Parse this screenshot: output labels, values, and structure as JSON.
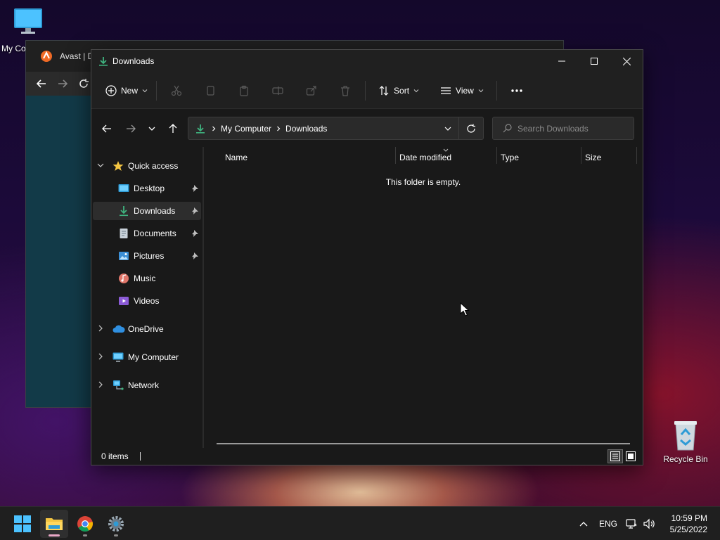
{
  "desktop": {
    "icons": [
      {
        "label": "My Co"
      },
      {
        "label": "Recycle Bin"
      }
    ]
  },
  "background_window": {
    "title": "Avast | Do"
  },
  "explorer": {
    "title": "Downloads",
    "commandbar": {
      "new_label": "New",
      "sort_label": "Sort",
      "view_label": "View"
    },
    "address": {
      "crumbs": [
        "My Computer",
        "Downloads"
      ]
    },
    "search": {
      "placeholder": "Search Downloads"
    },
    "navigation": {
      "quick_access": "Quick access",
      "pinned": [
        "Desktop",
        "Downloads",
        "Documents",
        "Pictures"
      ],
      "others": [
        "Music",
        "Videos"
      ],
      "roots": [
        "OneDrive",
        "My Computer",
        "Network"
      ]
    },
    "columns": [
      "Name",
      "Date modified",
      "Type",
      "Size"
    ],
    "empty_message": "This folder is empty.",
    "status": {
      "count": "0 items"
    }
  },
  "taskbar": {
    "language": "ENG",
    "time": "10:59 PM",
    "date": "5/25/2022"
  },
  "colors": {
    "accent_blue": "#4cc2ff",
    "downloads_green": "#3fb37f",
    "folder_yellow": "#f4c542",
    "chrome_indicator": "#8a8a8a",
    "explorer_indicator": "#e9a7c6"
  }
}
